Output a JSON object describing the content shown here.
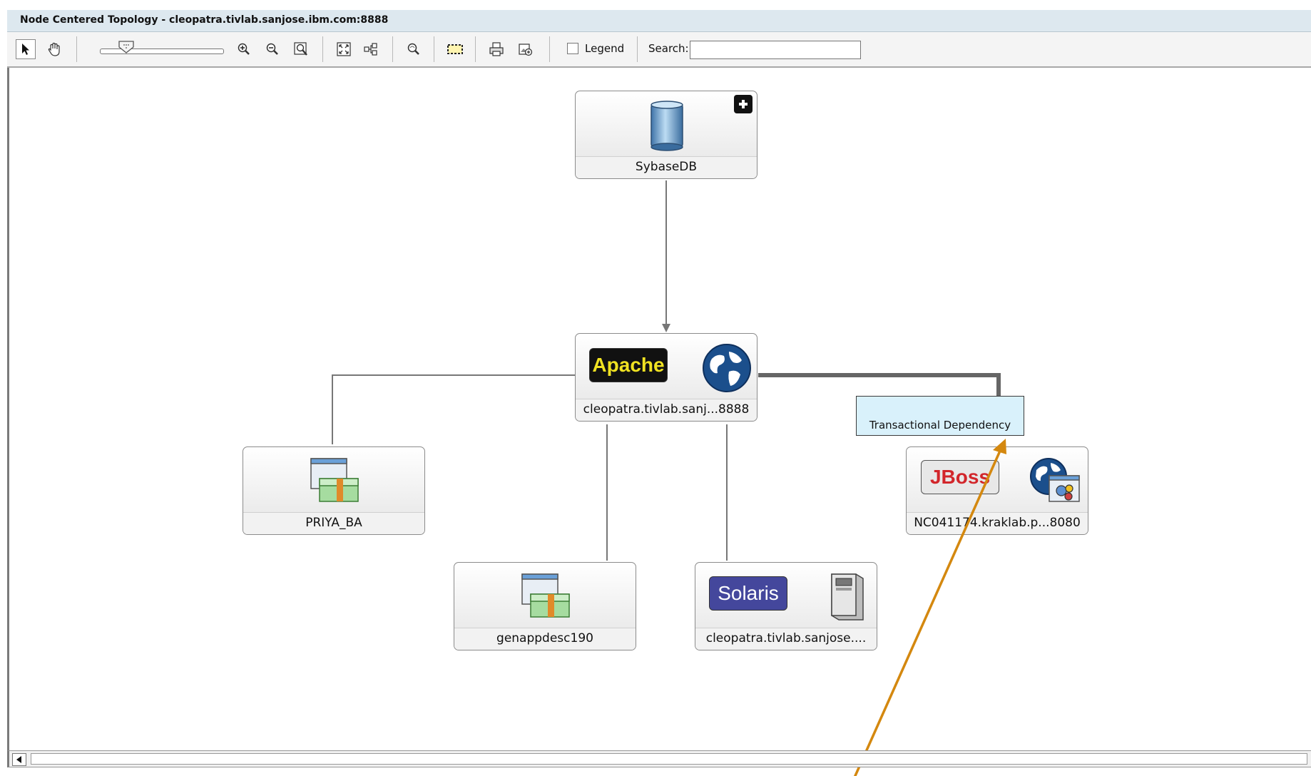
{
  "window": {
    "title": "Node Centered Topology - cleopatra.tivlab.sanjose.ibm.com:8888"
  },
  "toolbar": {
    "legend_label": "Legend",
    "legend_checked": false,
    "search_label": "Search:",
    "search_value": "",
    "tools": [
      "select-tool",
      "pan-tool",
      "zoom-slider",
      "zoom-in",
      "zoom-out",
      "zoom-region",
      "fit-content",
      "layout",
      "find-node",
      "marquee-select",
      "print",
      "export"
    ]
  },
  "nodes": {
    "sybase": {
      "label": "SybaseDB",
      "expand_icon": "plus"
    },
    "apache": {
      "label": "cleopatra.tivlab.sanj...8888",
      "badge": "Apache"
    },
    "priya": {
      "label": "PRIYA_BA"
    },
    "genapp": {
      "label": "genappdesc190"
    },
    "solaris": {
      "label": "cleopatra.tivlab.sanjose....",
      "badge": "Solaris"
    },
    "jboss": {
      "label": "NC041174.kraklab.p...8080",
      "badge": "JBoss"
    }
  },
  "tooltip": {
    "text": "Transactional Dependency"
  },
  "colors": {
    "titlebar": "#dde8ef",
    "tooltip_bg": "#d9f1fb",
    "annotation_arrow": "#d4880f",
    "edge": "#777777"
  }
}
